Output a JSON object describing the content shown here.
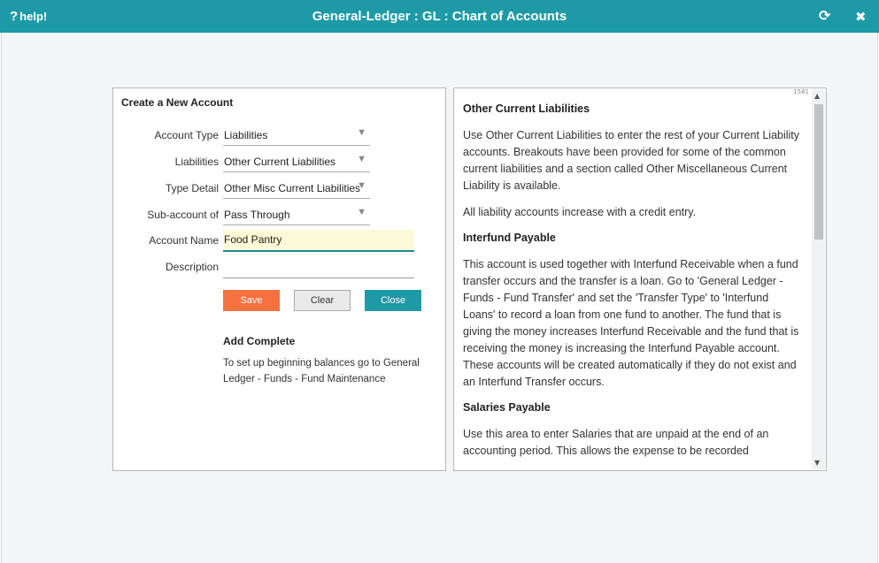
{
  "titlebar": {
    "help_label": "help!",
    "help_icon": "?",
    "title": "General-Ledger : GL : Chart of Accounts",
    "refresh_icon": "⟳",
    "close_icon": "✖"
  },
  "form": {
    "title": "Create a New Account",
    "account_type": {
      "label": "Account Type",
      "value": "Liabilities"
    },
    "liabilities": {
      "label": "Liabilities",
      "value": "Other Current Liabilities"
    },
    "type_detail": {
      "label": "Type Detail",
      "value": "Other Misc Current Liabilities"
    },
    "sub_account": {
      "label": "Sub-account of",
      "value": "Pass Through"
    },
    "account_name": {
      "label": "Account Name",
      "value": "Food Pantry"
    },
    "description": {
      "label": "Description",
      "value": ""
    },
    "buttons": {
      "save": "Save",
      "clear": "Clear",
      "close": "Close"
    },
    "complete": {
      "title": "Add Complete",
      "text": "To set up beginning balances go to General Ledger - Funds - Fund Maintenance"
    }
  },
  "help_panel": {
    "page_marker": "1581",
    "sections": [
      {
        "heading": "Other Current Liabilities",
        "paragraphs": [
          "Use Other Current Liabilities to enter the rest of your Current Liability accounts. Breakouts have been provided for some of the common current liabilities and a section called Other Miscellaneous Current Liability is available.",
          "All liability accounts increase with a credit entry."
        ]
      },
      {
        "heading": "Interfund Payable",
        "paragraphs": [
          "This account is used together with Interfund Receivable when a fund transfer occurs and the transfer is a loan. Go to 'General Ledger - Funds - Fund Transfer' and set the 'Transfer Type' to 'Interfund Loans' to record a loan from one fund to another. The fund that is giving the money increases Interfund Receivable and the fund that is receiving the money is increasing the Interfund Payable account. These accounts will be created automatically if they do not exist and an Interfund Transfer occurs."
        ]
      },
      {
        "heading": "Salaries Payable",
        "paragraphs": [
          "Use this area to enter Salaries that are unpaid at the end of an accounting period. This allows the expense to be recorded"
        ]
      }
    ]
  }
}
